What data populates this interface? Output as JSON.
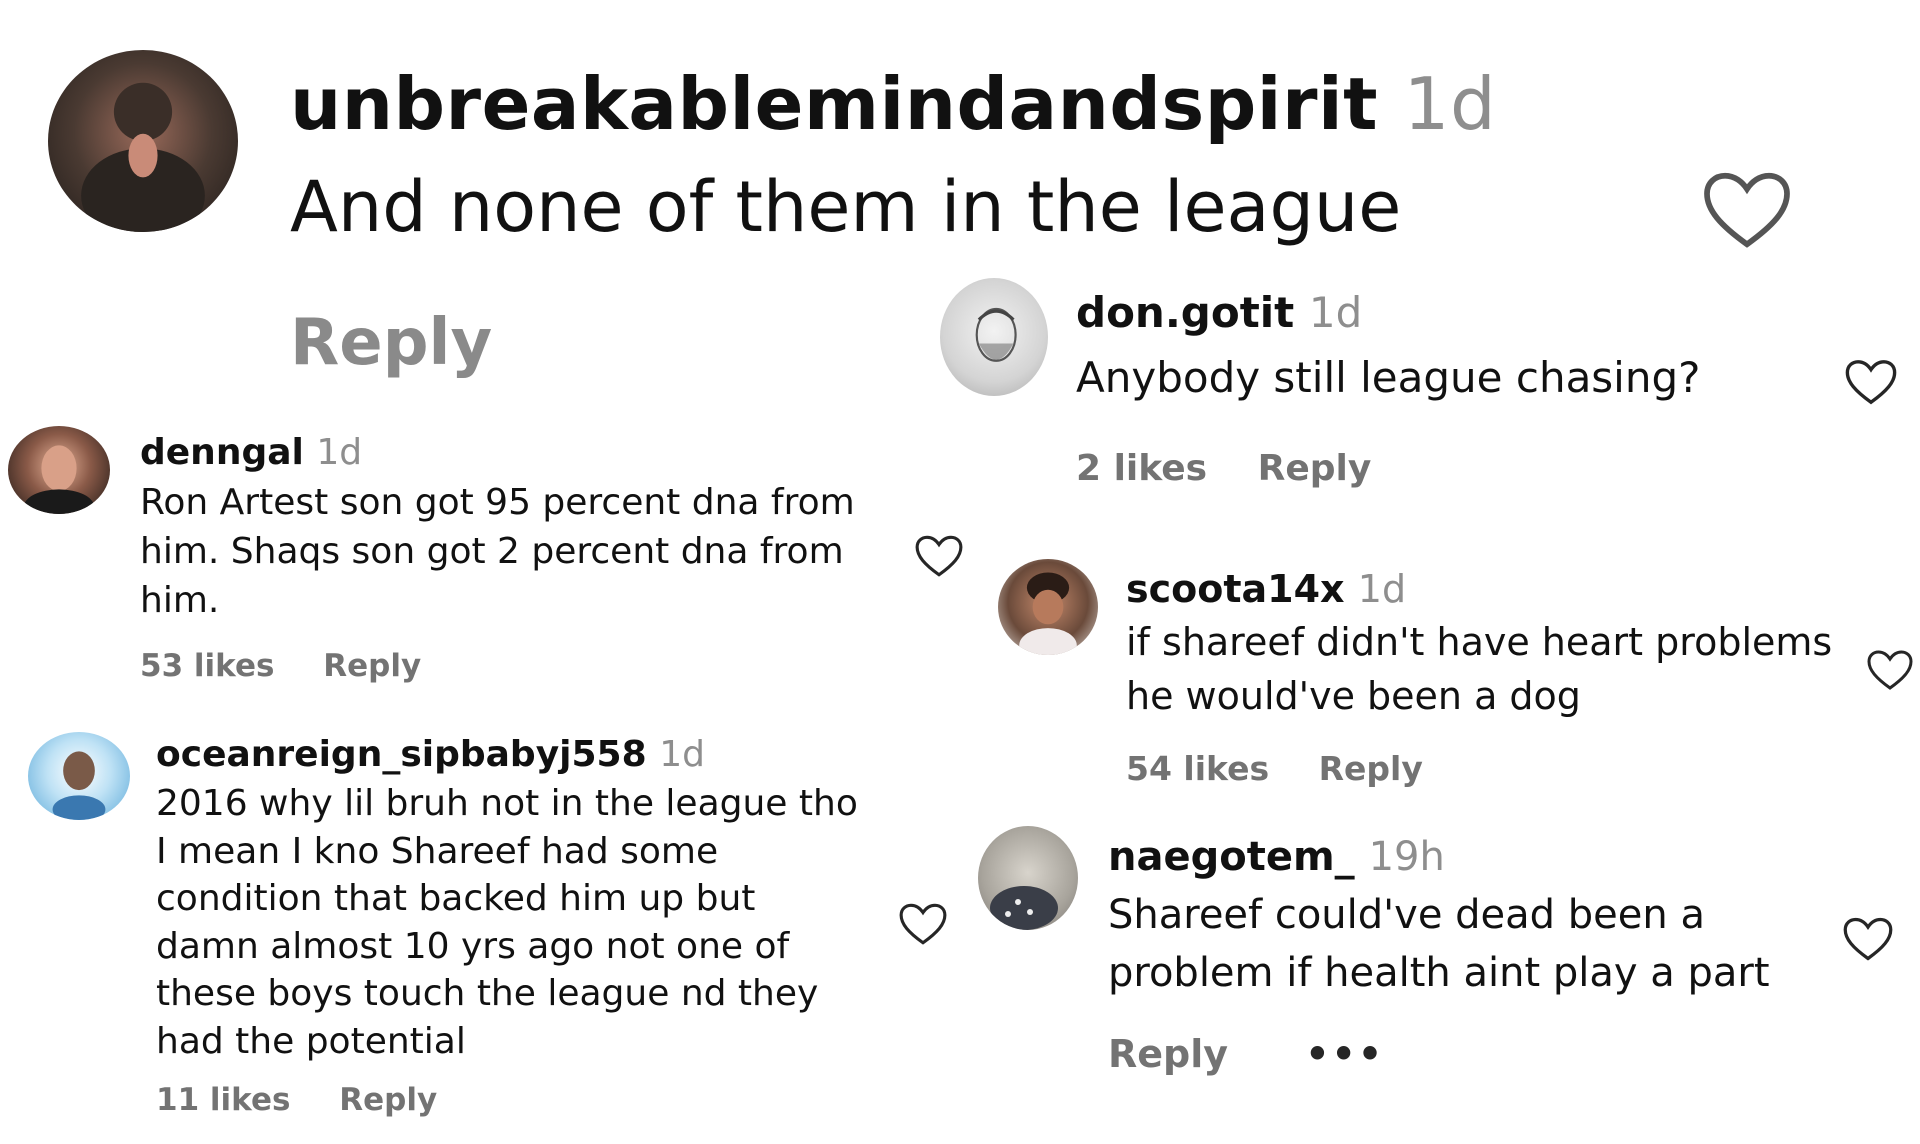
{
  "main_comment": {
    "username": "unbreakablemindandspirit",
    "time": "1d",
    "text": "And none of them in the league",
    "reply_label": "Reply"
  },
  "comments": [
    {
      "username": "denngal",
      "time": "1d",
      "text": "Ron Artest son got 95 percent dna from him. Shaqs son got 2 percent dna from him.",
      "likes": "53 likes",
      "reply_label": "Reply"
    },
    {
      "username": "oceanreign_sipbabyj558",
      "time": "1d",
      "text": "2016 why lil bruh not in the league tho I mean I kno Shareef had some condition that backed him up but damn almost 10 yrs ago not one of these boys touch the league nd they had the potential",
      "likes": "11 likes",
      "reply_label": "Reply"
    },
    {
      "username": "don.gotit",
      "time": "1d",
      "text": "Anybody still league chasing?",
      "likes": "2 likes",
      "reply_label": "Reply"
    },
    {
      "username": "scoota14x",
      "time": "1d",
      "text": "if shareef didn't have heart problems he would've been a dog",
      "likes": "54 likes",
      "reply_label": "Reply"
    },
    {
      "username": "naegotem_",
      "time": "19h",
      "text": "Shareef could've dead been a problem if health aint play a part",
      "reply_label": "Reply",
      "more_label": "•••"
    }
  ],
  "icons": {
    "like": "heart-outline-icon",
    "more": "more-options-icon"
  },
  "colors": {
    "text": "#111111",
    "secondary": "#737373",
    "time": "#8e8e8e",
    "heart_stroke": "#262626"
  }
}
